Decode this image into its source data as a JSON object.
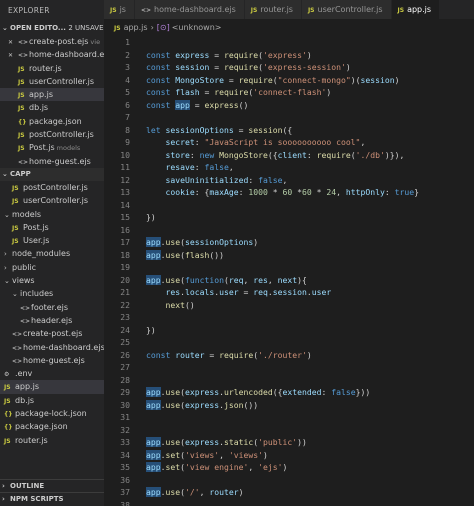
{
  "explorer": {
    "title": "EXPLORER",
    "open_editors": {
      "label": "OPEN EDITO...",
      "badge": "2 UNSAVED",
      "items": [
        {
          "icon": "ejs",
          "name": "create-post.ejs",
          "hint": "vie"
        },
        {
          "icon": "ejs",
          "name": "home-dashboard.ejs",
          "hint": ""
        },
        {
          "icon": "js",
          "name": "router.js",
          "hint": ""
        },
        {
          "icon": "js",
          "name": "userController.js",
          "hint": ""
        },
        {
          "icon": "js",
          "name": "app.js",
          "hint": "",
          "active": true
        },
        {
          "icon": "js",
          "name": "db.js",
          "hint": ""
        },
        {
          "icon": "json",
          "name": "package.json",
          "hint": ""
        },
        {
          "icon": "js",
          "name": "postController.js",
          "hint": ""
        },
        {
          "icon": "js",
          "name": "Post.js",
          "hint": "models"
        },
        {
          "icon": "ejs",
          "name": "home-guest.ejs",
          "hint": ""
        }
      ]
    },
    "project": {
      "label": "CAPP",
      "items": [
        {
          "type": "file",
          "icon": "js",
          "name": "postController.js",
          "depth": 1
        },
        {
          "type": "file",
          "icon": "js",
          "name": "userController.js",
          "depth": 1
        },
        {
          "type": "folder",
          "open": true,
          "name": "models",
          "depth": 0
        },
        {
          "type": "file",
          "icon": "js",
          "name": "Post.js",
          "depth": 1
        },
        {
          "type": "file",
          "icon": "js",
          "name": "User.js",
          "depth": 1
        },
        {
          "type": "folder",
          "open": false,
          "name": "node_modules",
          "depth": 0
        },
        {
          "type": "folder",
          "open": false,
          "name": "public",
          "depth": 0
        },
        {
          "type": "folder",
          "open": true,
          "name": "views",
          "depth": 0
        },
        {
          "type": "folder",
          "open": true,
          "name": "includes",
          "depth": 1
        },
        {
          "type": "file",
          "icon": "ejs",
          "name": "footer.ejs",
          "depth": 2
        },
        {
          "type": "file",
          "icon": "ejs",
          "name": "header.ejs",
          "depth": 2
        },
        {
          "type": "file",
          "icon": "ejs",
          "name": "create-post.ejs",
          "depth": 1
        },
        {
          "type": "file",
          "icon": "ejs",
          "name": "home-dashboard.ejs",
          "depth": 1
        },
        {
          "type": "file",
          "icon": "ejs",
          "name": "home-guest.ejs",
          "depth": 1
        },
        {
          "type": "file",
          "icon": "env",
          "name": ".env",
          "depth": 0
        },
        {
          "type": "file",
          "icon": "js",
          "name": "app.js",
          "depth": 0,
          "active": true
        },
        {
          "type": "file",
          "icon": "js",
          "name": "db.js",
          "depth": 0
        },
        {
          "type": "file",
          "icon": "json",
          "name": "package-lock.json",
          "depth": 0
        },
        {
          "type": "file",
          "icon": "json",
          "name": "package.json",
          "depth": 0
        },
        {
          "type": "file",
          "icon": "js",
          "name": "router.js",
          "depth": 0
        }
      ]
    },
    "outline_label": "OUTLINE",
    "npm_label": "NPM SCRIPTS"
  },
  "tabs": [
    {
      "icon": "js",
      "label": "js",
      "active": false
    },
    {
      "icon": "ejs",
      "label": "home-dashboard.ejs",
      "active": false
    },
    {
      "icon": "js",
      "label": "router.js",
      "active": false
    },
    {
      "icon": "js",
      "label": "userController.js",
      "active": false
    },
    {
      "icon": "js",
      "label": "app.js",
      "active": true
    }
  ],
  "breadcrumb": {
    "file": "app.js",
    "symbol": "<unknown>"
  },
  "icon_labels": {
    "js": "JS",
    "json": "{}",
    "ejs": "<>",
    "env": "⚙"
  },
  "colors": {
    "keyword": "#569cd6",
    "variable": "#9cdcfe",
    "function": "#dcdcaa",
    "string": "#ce9178",
    "number": "#b5cea8",
    "js_icon": "#cbcb41"
  },
  "code_lines": [
    {
      "n": "1",
      "t": []
    },
    {
      "n": "2",
      "t": [
        [
          "k",
          "const "
        ],
        [
          "v",
          "express"
        ],
        [
          "p",
          " = "
        ],
        [
          "f",
          "require"
        ],
        [
          "p",
          "("
        ],
        [
          "s",
          "'express'"
        ],
        [
          "p",
          ")"
        ]
      ]
    },
    {
      "n": "3",
      "t": [
        [
          "k",
          "const "
        ],
        [
          "v",
          "session"
        ],
        [
          "p",
          " = "
        ],
        [
          "f",
          "require"
        ],
        [
          "p",
          "("
        ],
        [
          "s",
          "'express-session'"
        ],
        [
          "p",
          ")"
        ]
      ]
    },
    {
      "n": "4",
      "t": [
        [
          "k",
          "const "
        ],
        [
          "v",
          "MongoStore"
        ],
        [
          "p",
          " = "
        ],
        [
          "f",
          "require"
        ],
        [
          "p",
          "("
        ],
        [
          "s",
          "\"connect-mongo\""
        ],
        [
          "p",
          ")("
        ],
        [
          "v",
          "session"
        ],
        [
          "p",
          ")"
        ]
      ]
    },
    {
      "n": "5",
      "t": [
        [
          "k",
          "const "
        ],
        [
          "v",
          "flash"
        ],
        [
          "p",
          " = "
        ],
        [
          "f",
          "require"
        ],
        [
          "p",
          "("
        ],
        [
          "s",
          "'connect-flash'"
        ],
        [
          "p",
          ")"
        ]
      ]
    },
    {
      "n": "6",
      "t": [
        [
          "k",
          "const "
        ],
        [
          "hl",
          "app"
        ],
        [
          "p",
          " = "
        ],
        [
          "f",
          "express"
        ],
        [
          "p",
          "()"
        ]
      ]
    },
    {
      "n": "7",
      "t": []
    },
    {
      "n": "8",
      "t": [
        [
          "k",
          "let "
        ],
        [
          "v",
          "sessionOptions"
        ],
        [
          "p",
          " = "
        ],
        [
          "f",
          "session"
        ],
        [
          "p",
          "({"
        ]
      ]
    },
    {
      "n": "9",
      "t": [
        [
          "p",
          "    "
        ],
        [
          "v",
          "secret"
        ],
        [
          "p",
          ": "
        ],
        [
          "s",
          "\"JavaScript is soooooooooo cool\""
        ],
        [
          "p",
          ","
        ]
      ]
    },
    {
      "n": "10",
      "t": [
        [
          "p",
          "    "
        ],
        [
          "v",
          "store"
        ],
        [
          "p",
          ": "
        ],
        [
          "k",
          "new "
        ],
        [
          "f",
          "MongoStore"
        ],
        [
          "p",
          "({"
        ],
        [
          "v",
          "client"
        ],
        [
          "p",
          ": "
        ],
        [
          "f",
          "require"
        ],
        [
          "p",
          "("
        ],
        [
          "s",
          "'./db'"
        ],
        [
          "p",
          ")}),"
        ]
      ]
    },
    {
      "n": "11",
      "t": [
        [
          "p",
          "    "
        ],
        [
          "v",
          "resave"
        ],
        [
          "p",
          ": "
        ],
        [
          "k",
          "false"
        ],
        [
          "p",
          ","
        ]
      ]
    },
    {
      "n": "12",
      "t": [
        [
          "p",
          "    "
        ],
        [
          "v",
          "saveUninitialized"
        ],
        [
          "p",
          ": "
        ],
        [
          "k",
          "false"
        ],
        [
          "p",
          ","
        ]
      ]
    },
    {
      "n": "13",
      "t": [
        [
          "p",
          "    "
        ],
        [
          "v",
          "cookie"
        ],
        [
          "p",
          ": {"
        ],
        [
          "v",
          "maxAge"
        ],
        [
          "p",
          ": "
        ],
        [
          "n",
          "1000"
        ],
        [
          "p",
          " * "
        ],
        [
          "n",
          "60"
        ],
        [
          "p",
          " *"
        ],
        [
          "n",
          "60"
        ],
        [
          "p",
          " * "
        ],
        [
          "n",
          "24"
        ],
        [
          "p",
          ", "
        ],
        [
          "v",
          "httpOnly"
        ],
        [
          "p",
          ": "
        ],
        [
          "k",
          "true"
        ],
        [
          "p",
          "}"
        ]
      ]
    },
    {
      "n": "14",
      "t": []
    },
    {
      "n": "15",
      "t": [
        [
          "p",
          "})"
        ]
      ]
    },
    {
      "n": "16",
      "t": []
    },
    {
      "n": "17",
      "t": [
        [
          "hl",
          "app"
        ],
        [
          "p",
          "."
        ],
        [
          "f",
          "use"
        ],
        [
          "p",
          "("
        ],
        [
          "v",
          "sessionOptions"
        ],
        [
          "p",
          ")"
        ]
      ]
    },
    {
      "n": "18",
      "t": [
        [
          "hl",
          "app"
        ],
        [
          "p",
          "."
        ],
        [
          "f",
          "use"
        ],
        [
          "p",
          "("
        ],
        [
          "f",
          "flash"
        ],
        [
          "p",
          "())"
        ]
      ]
    },
    {
      "n": "19",
      "t": []
    },
    {
      "n": "20",
      "t": [
        [
          "hl",
          "app"
        ],
        [
          "p",
          "."
        ],
        [
          "f",
          "use"
        ],
        [
          "p",
          "("
        ],
        [
          "k",
          "function"
        ],
        [
          "p",
          "("
        ],
        [
          "v",
          "req"
        ],
        [
          "p",
          ", "
        ],
        [
          "v",
          "res"
        ],
        [
          "p",
          ", "
        ],
        [
          "v",
          "next"
        ],
        [
          "p",
          "){"
        ]
      ]
    },
    {
      "n": "21",
      "t": [
        [
          "p",
          "    "
        ],
        [
          "v",
          "res"
        ],
        [
          "p",
          "."
        ],
        [
          "v",
          "locals"
        ],
        [
          "p",
          "."
        ],
        [
          "v",
          "user"
        ],
        [
          "p",
          " = "
        ],
        [
          "v",
          "req"
        ],
        [
          "p",
          "."
        ],
        [
          "v",
          "session"
        ],
        [
          "p",
          "."
        ],
        [
          "v",
          "user"
        ]
      ]
    },
    {
      "n": "22",
      "t": [
        [
          "p",
          "    "
        ],
        [
          "f",
          "next"
        ],
        [
          "p",
          "()"
        ]
      ]
    },
    {
      "n": "23",
      "t": []
    },
    {
      "n": "24",
      "t": [
        [
          "p",
          "})"
        ]
      ]
    },
    {
      "n": "25",
      "t": []
    },
    {
      "n": "26",
      "t": [
        [
          "k",
          "const "
        ],
        [
          "v",
          "router"
        ],
        [
          "p",
          " = "
        ],
        [
          "f",
          "require"
        ],
        [
          "p",
          "("
        ],
        [
          "s",
          "'./router'"
        ],
        [
          "p",
          ")"
        ]
      ]
    },
    {
      "n": "27",
      "t": []
    },
    {
      "n": "28",
      "t": []
    },
    {
      "n": "29",
      "t": [
        [
          "hl",
          "app"
        ],
        [
          "p",
          "."
        ],
        [
          "f",
          "use"
        ],
        [
          "p",
          "("
        ],
        [
          "v",
          "express"
        ],
        [
          "p",
          "."
        ],
        [
          "f",
          "urlencoded"
        ],
        [
          "p",
          "({"
        ],
        [
          "v",
          "extended"
        ],
        [
          "p",
          ": "
        ],
        [
          "k",
          "false"
        ],
        [
          "p",
          "}))"
        ]
      ]
    },
    {
      "n": "30",
      "t": [
        [
          "hl",
          "app"
        ],
        [
          "p",
          "."
        ],
        [
          "f",
          "use"
        ],
        [
          "p",
          "("
        ],
        [
          "v",
          "express"
        ],
        [
          "p",
          "."
        ],
        [
          "f",
          "json"
        ],
        [
          "p",
          "())"
        ]
      ]
    },
    {
      "n": "31",
      "t": []
    },
    {
      "n": "32",
      "t": []
    },
    {
      "n": "33",
      "t": [
        [
          "hl",
          "app"
        ],
        [
          "p",
          "."
        ],
        [
          "f",
          "use"
        ],
        [
          "p",
          "("
        ],
        [
          "v",
          "express"
        ],
        [
          "p",
          "."
        ],
        [
          "f",
          "static"
        ],
        [
          "p",
          "("
        ],
        [
          "s",
          "'public'"
        ],
        [
          "p",
          "))"
        ]
      ]
    },
    {
      "n": "34",
      "t": [
        [
          "hl",
          "app"
        ],
        [
          "p",
          "."
        ],
        [
          "f",
          "set"
        ],
        [
          "p",
          "("
        ],
        [
          "s",
          "'views'"
        ],
        [
          "p",
          ", "
        ],
        [
          "s",
          "'views'"
        ],
        [
          "p",
          ")"
        ]
      ]
    },
    {
      "n": "35",
      "t": [
        [
          "hl",
          "app"
        ],
        [
          "p",
          "."
        ],
        [
          "f",
          "set"
        ],
        [
          "p",
          "("
        ],
        [
          "s",
          "'view engine'"
        ],
        [
          "p",
          ", "
        ],
        [
          "s",
          "'ejs'"
        ],
        [
          "p",
          ")"
        ]
      ]
    },
    {
      "n": "36",
      "t": []
    },
    {
      "n": "37",
      "t": [
        [
          "hl",
          "app"
        ],
        [
          "p",
          "."
        ],
        [
          "f",
          "use"
        ],
        [
          "p",
          "("
        ],
        [
          "s",
          "'/'"
        ],
        [
          "p",
          ", "
        ],
        [
          "v",
          "router"
        ],
        [
          "p",
          ")"
        ]
      ]
    },
    {
      "n": "38",
      "t": []
    },
    {
      "n": "39",
      "t": [
        [
          "v",
          "module"
        ],
        [
          "p",
          "."
        ],
        [
          "v",
          "exports"
        ],
        [
          "p",
          " = "
        ],
        [
          "hl",
          "app"
        ]
      ],
      "current": true
    }
  ]
}
